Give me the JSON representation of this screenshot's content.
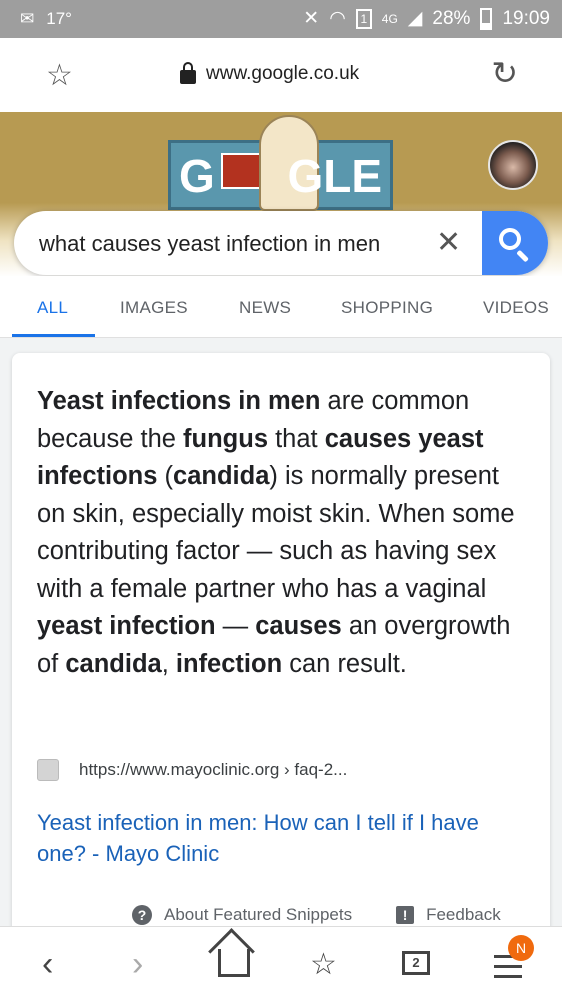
{
  "status_bar": {
    "temperature": "17°",
    "sim_label": "1",
    "network": "4G",
    "battery": "28%",
    "time": "19:09"
  },
  "address_bar": {
    "url": "www.google.co.uk"
  },
  "search": {
    "query": "what causes yeast infection in men"
  },
  "tabs": [
    {
      "label": "ALL"
    },
    {
      "label": "IMAGES"
    },
    {
      "label": "NEWS"
    },
    {
      "label": "SHOPPING"
    },
    {
      "label": "VIDEOS"
    }
  ],
  "doodle": {
    "left_letter": "G",
    "right_letters": "GLE"
  },
  "featured_snippet": {
    "segments": [
      {
        "text": "Yeast infections in men",
        "bold": true
      },
      {
        "text": " are common because the ",
        "bold": false
      },
      {
        "text": "fungus",
        "bold": true
      },
      {
        "text": " that ",
        "bold": false
      },
      {
        "text": "causes yeast infections",
        "bold": true
      },
      {
        "text": " (",
        "bold": false
      },
      {
        "text": "candida",
        "bold": true
      },
      {
        "text": ") is normally present on skin, especially moist skin. When some contributing factor — such as having sex with a female partner who has a vaginal ",
        "bold": false
      },
      {
        "text": "yeast infection",
        "bold": true
      },
      {
        "text": " — ",
        "bold": false
      },
      {
        "text": "causes",
        "bold": true
      },
      {
        "text": " an overgrowth of ",
        "bold": false
      },
      {
        "text": "candida",
        "bold": true
      },
      {
        "text": ", ",
        "bold": false
      },
      {
        "text": "infection",
        "bold": true
      },
      {
        "text": " can result.",
        "bold": false
      }
    ],
    "source_url": "https://www.mayoclinic.org › faq-2...",
    "result_title": "Yeast infection in men: How can I tell if I have one? - Mayo Clinic",
    "about_label": "About Featured Snippets",
    "feedback_label": "Feedback"
  },
  "bottom_nav": {
    "tabs_count": "2",
    "menu_badge": "N"
  }
}
